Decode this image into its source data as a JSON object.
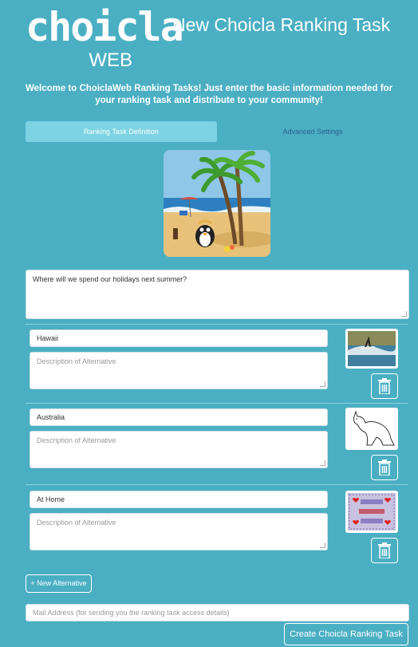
{
  "app": {
    "logo_main": "choicla",
    "logo_sub": "WEB",
    "title": "New Choicla Ranking Task"
  },
  "welcome": "Welcome to ChoiclaWeb Ranking Tasks! Just enter the basic information needed for your ranking task and distribute to your community!",
  "tabs": [
    {
      "label": "Ranking Task Definition",
      "active": true
    },
    {
      "label": "Advanced Settings",
      "active": false
    }
  ],
  "question": {
    "value": "Where will we spend our holidays next summer?"
  },
  "alternatives": [
    {
      "name": "Hawaii",
      "description_placeholder": "Description of Alternative",
      "image": "surfer-photo"
    },
    {
      "name": "Australia",
      "description_placeholder": "Description of Alternative",
      "image": "kangaroo-drawing"
    },
    {
      "name": "At Home",
      "description_placeholder": "Description of Alternative",
      "image": "home-sweet-home-sign"
    }
  ],
  "new_alternative_label": "+ New Alternative",
  "email": {
    "placeholder": "Mail Address (for sending you the ranking task access details)"
  },
  "create_label": "Create Choicla Ranking Task",
  "colors": {
    "background": "#4aafc3",
    "active_tab": "#7dd3e3",
    "link": "#2d5f8e"
  }
}
